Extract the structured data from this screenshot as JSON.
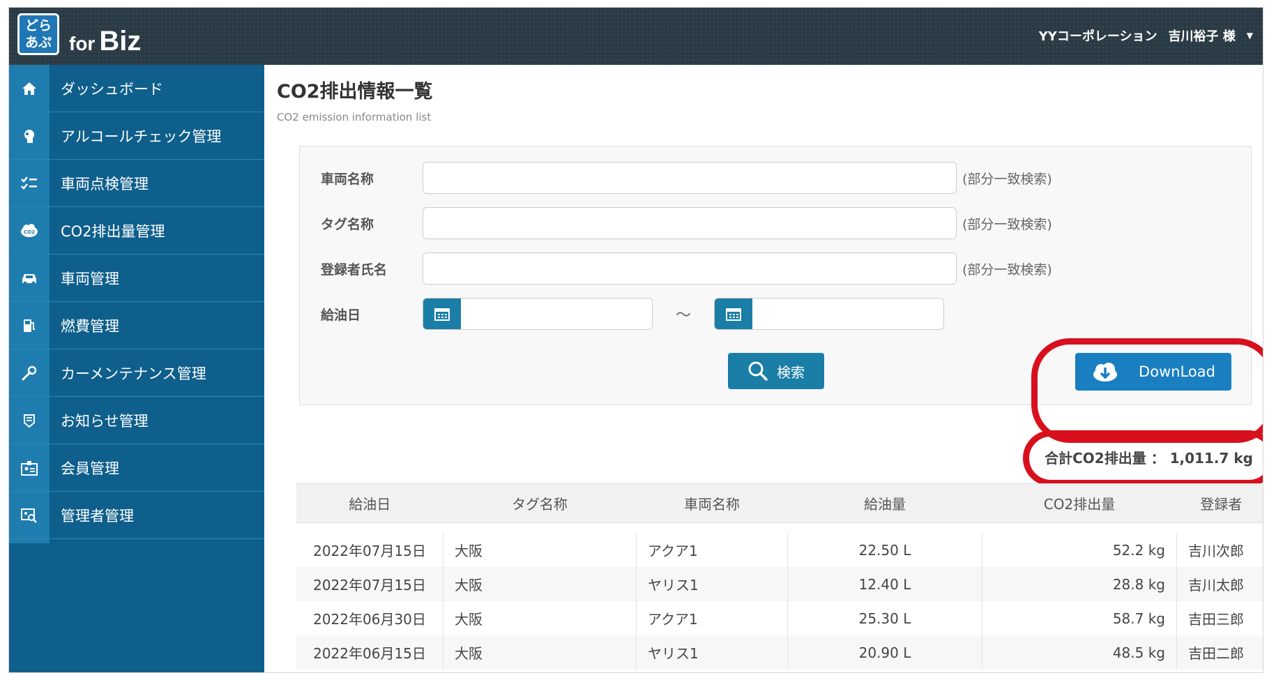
{
  "header": {
    "logo_line1": "どら",
    "logo_line2": "あぷ",
    "brand_for": "for",
    "brand_biz": "Biz",
    "company": "YYコーポレーション",
    "user": "吉川裕子 様"
  },
  "sidebar": {
    "items": [
      {
        "label": "ダッシュボード",
        "icon": "home-icon"
      },
      {
        "label": "アルコールチェック管理",
        "icon": "alcohol-check-icon"
      },
      {
        "label": "車両点検管理",
        "icon": "checklist-icon"
      },
      {
        "label": "CO2排出量管理",
        "icon": "co2-cloud-icon"
      },
      {
        "label": "車両管理",
        "icon": "car-icon"
      },
      {
        "label": "燃費管理",
        "icon": "fuel-pump-icon"
      },
      {
        "label": "カーメンテナンス管理",
        "icon": "wrench-icon"
      },
      {
        "label": "お知らせ管理",
        "icon": "notice-icon"
      },
      {
        "label": "会員管理",
        "icon": "member-card-icon"
      },
      {
        "label": "管理者管理",
        "icon": "admin-search-icon"
      }
    ]
  },
  "main": {
    "title": "CO2排出情報一覧",
    "subtitle": "CO2 emission information list",
    "form": {
      "vehicle_label": "車両名称",
      "tag_label": "タグ名称",
      "registrant_label": "登録者氏名",
      "partial_hint": "(部分一致検索)",
      "date_label": "給油日",
      "range_sep": "～",
      "search_label": "検索",
      "download_label": "DownLoad"
    },
    "total_text": "合計CO2排出量 ： 1,011.7 kg",
    "table": {
      "headers": [
        "給油日",
        "タグ名称",
        "車両名称",
        "給油量",
        "CO2排出量",
        "登録者"
      ],
      "rows": [
        [
          "2022年07月15日",
          "大阪",
          "アクア1",
          "22.50 L",
          "52.2 kg",
          "吉川次郎"
        ],
        [
          "2022年07月15日",
          "大阪",
          "ヤリス1",
          "12.40 L",
          "28.8 kg",
          "吉川太郎"
        ],
        [
          "2022年06月30日",
          "大阪",
          "アクア1",
          "25.30 L",
          "58.7 kg",
          "吉田三郎"
        ],
        [
          "2022年06月15日",
          "大阪",
          "ヤリス1",
          "20.90 L",
          "48.5 kg",
          "吉田二郎"
        ]
      ]
    }
  },
  "colors": {
    "sidebar_bg": "#0f5f8c",
    "sidebar_icon_col": "#1f7cae",
    "button_teal": "#1a7ea7",
    "highlight_red": "#d8101e"
  }
}
